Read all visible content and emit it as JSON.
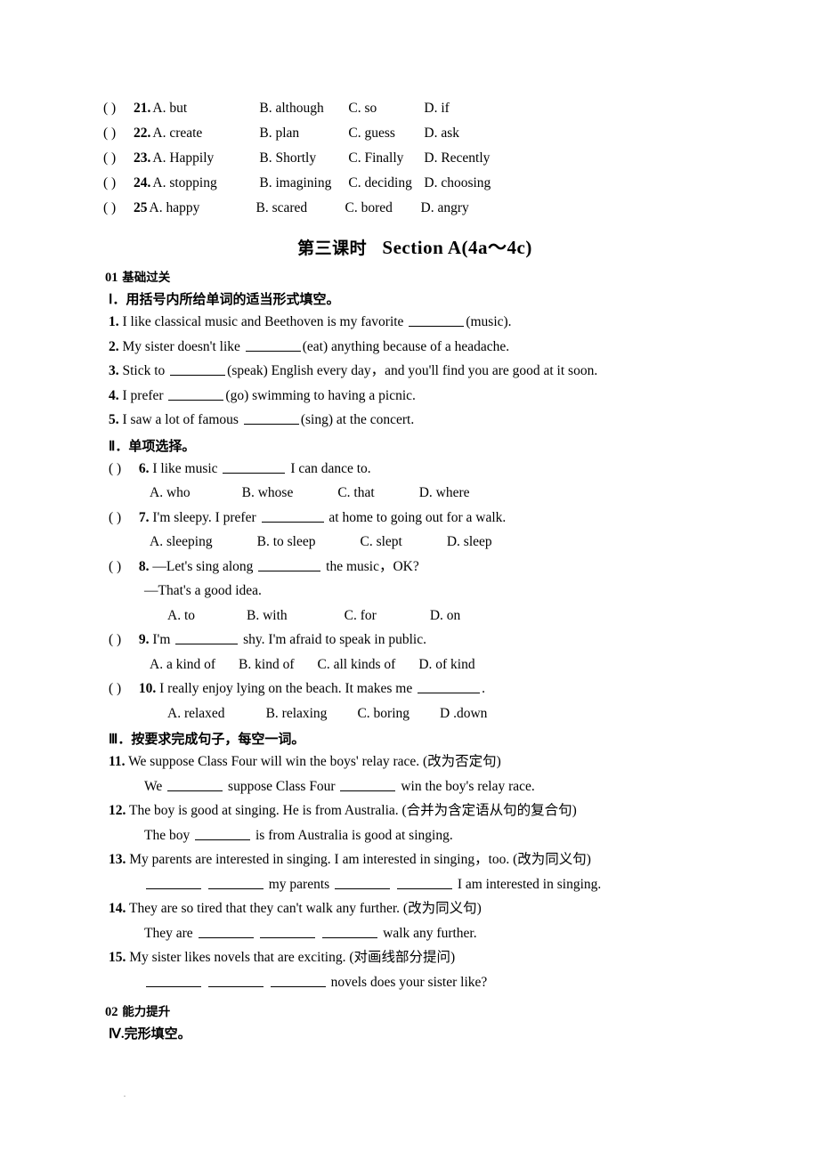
{
  "mc_top": [
    {
      "paren": "(    )",
      "num": "21.",
      "a": "A. but",
      "b": "B. although",
      "c": "C. so",
      "d": "D. if"
    },
    {
      "paren": "(    )",
      "num": "22.",
      "a": "A. create",
      "b": "B. plan",
      "c": "C. guess",
      "d": "D. ask"
    },
    {
      "paren": "(    )",
      "num": "23.",
      "a": "A. Happily",
      "b": "B. Shortly",
      "c": "C. Finally",
      "d": "D. Recently"
    },
    {
      "paren": "(    )",
      "num": "24.",
      "a": "A. stopping",
      "b": "B. imagining",
      "c": "C. deciding",
      "d": "D. choosing"
    },
    {
      "paren": "(    )",
      "num": "25",
      "a": "A. happy",
      "b": "B. scared",
      "c": "C. bored",
      "d": "D. angry"
    }
  ],
  "section_heading": {
    "cn": "第三课时",
    "en": "Section A(4a～4c)"
  },
  "part1": {
    "num": "01",
    "label": "基础过关",
    "roman": "Ⅰ．",
    "roman_text": "用括号内所给单词的适当形式填空。",
    "items": [
      {
        "n": "1.",
        "pre": "I like classical music and Beethoven is my favorite",
        "post": "(music)."
      },
      {
        "n": "2.",
        "pre": "My sister doesn't like",
        "post": "(eat) anything because of a headache."
      },
      {
        "n": "3.",
        "pre": "Stick to",
        "post": "(speak) English every day，and you'll find you are good at it soon."
      },
      {
        "n": "4.",
        "pre": "I prefer",
        "post": "(go) swimming to having a picnic."
      },
      {
        "n": "5.",
        "pre": "I saw a lot of famous",
        "post": "(sing) at the concert."
      }
    ]
  },
  "part2": {
    "roman": "Ⅱ．",
    "roman_text": "单项选择。",
    "items": [
      {
        "paren": "(    )",
        "n": "6.",
        "stem_pre": "I like music",
        "stem_post": "I can dance to.",
        "choices": [
          "A. who",
          "B. whose",
          "C. that",
          "D. where"
        ]
      },
      {
        "paren": "(    )",
        "n": "7.",
        "stem_pre": "I'm sleepy. I prefer",
        "stem_post": "at home to going out for a walk.",
        "choices": [
          "A. sleeping",
          "B. to sleep",
          "C. slept",
          "D. sleep"
        ]
      },
      {
        "paren": "(    )",
        "n": "8.",
        "stem_pre": "—Let's sing along",
        "stem_post": "the music，OK?",
        "stem_line2": "—That's a good idea.",
        "choices": [
          "A. to",
          "B. with",
          "C. for",
          "D. on"
        ]
      },
      {
        "paren": "(    )",
        "n": "9.",
        "stem_pre": "I'm",
        "stem_post": "shy. I'm afraid to speak in public.",
        "choices": [
          "A. a kind of",
          "B. kind of",
          "C. all kinds of",
          "D. of kind"
        ]
      },
      {
        "paren": "(    )",
        "n": "10.",
        "stem_pre": "I really enjoy lying on the beach. It makes me",
        "stem_post": ".",
        "choices": [
          "A. relaxed",
          "B. relaxing",
          "C. boring",
          "D .down"
        ]
      }
    ]
  },
  "part3": {
    "roman": "Ⅲ．",
    "roman_text": "按要求完成句子，每空一词。",
    "items": [
      {
        "n": "11.",
        "stem": "We suppose Class Four will win the boys' relay race. (改为否定句)",
        "answer_pre": "We",
        "answer_mid": "suppose Class Four",
        "answer_post": "win the boy's relay race."
      },
      {
        "n": "12.",
        "stem": "The boy is good at singing. He is from Australia. (合并为含定语从句的复合句)",
        "answer_pre": "The boy",
        "answer_post": "is from Australia is good at singing."
      },
      {
        "n": "13.",
        "stem": "My parents are interested in singing. I am interested in singing，too. (改为同义句)",
        "answer_pre": "",
        "answer_mid": "my parents",
        "answer_post": "I am interested in singing."
      },
      {
        "n": "14.",
        "stem": "They are so tired that they can't walk any further. (改为同义句)",
        "answer_pre": "They are",
        "answer_post": "walk any further."
      },
      {
        "n": "15.",
        "stem": "My sister likes novels that are exciting. (对画线部分提问)",
        "answer_post": "novels does your sister like?"
      }
    ]
  },
  "part4": {
    "num": "02",
    "label": "能力提升",
    "roman": "Ⅳ.",
    "roman_text": "完形填空。"
  }
}
